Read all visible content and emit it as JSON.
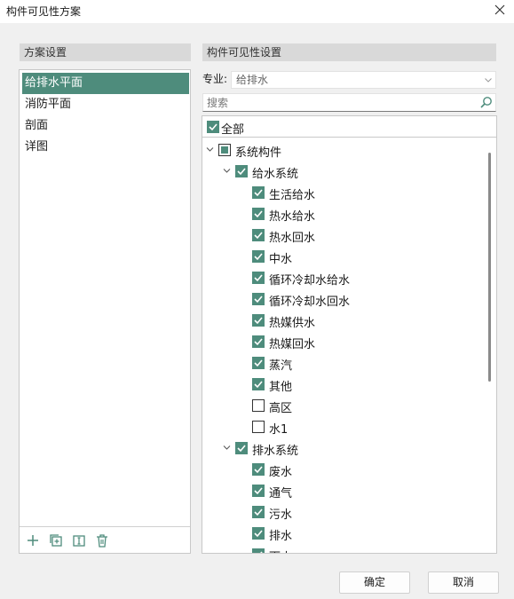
{
  "window": {
    "title": "构件可见性方案"
  },
  "left": {
    "header": "方案设置",
    "items": [
      {
        "label": "给排水平面",
        "selected": true
      },
      {
        "label": "消防平面",
        "selected": false
      },
      {
        "label": "剖面",
        "selected": false
      },
      {
        "label": "详图",
        "selected": false
      }
    ],
    "toolbar": [
      "add-icon",
      "copy-icon",
      "rename-icon",
      "delete-icon"
    ]
  },
  "right": {
    "header": "构件可见性设置",
    "major_label": "专业:",
    "major_value": "给排水",
    "search_placeholder": "搜索",
    "all_label": "全部",
    "tree": [
      {
        "label": "系统构件",
        "state": "partial",
        "level": 0,
        "expanded": true
      },
      {
        "label": "给水系统",
        "state": "checked",
        "level": 1,
        "expanded": true
      },
      {
        "label": "生活给水",
        "state": "checked",
        "level": 2
      },
      {
        "label": "热水给水",
        "state": "checked",
        "level": 2
      },
      {
        "label": "热水回水",
        "state": "checked",
        "level": 2
      },
      {
        "label": "中水",
        "state": "checked",
        "level": 2
      },
      {
        "label": "循环冷却水给水",
        "state": "checked",
        "level": 2
      },
      {
        "label": "循环冷却水回水",
        "state": "checked",
        "level": 2
      },
      {
        "label": "热媒供水",
        "state": "checked",
        "level": 2
      },
      {
        "label": "热媒回水",
        "state": "checked",
        "level": 2
      },
      {
        "label": "蒸汽",
        "state": "checked",
        "level": 2
      },
      {
        "label": "其他",
        "state": "checked",
        "level": 2
      },
      {
        "label": "高区",
        "state": "unchecked",
        "level": 2
      },
      {
        "label": "水1",
        "state": "unchecked",
        "level": 2
      },
      {
        "label": "排水系统",
        "state": "checked",
        "level": 1,
        "expanded": true
      },
      {
        "label": "废水",
        "state": "checked",
        "level": 2
      },
      {
        "label": "通气",
        "state": "checked",
        "level": 2
      },
      {
        "label": "污水",
        "state": "checked",
        "level": 2
      },
      {
        "label": "排水",
        "state": "checked",
        "level": 2
      },
      {
        "label": "雨水",
        "state": "checked",
        "level": 2
      }
    ]
  },
  "buttons": {
    "ok": "确定",
    "cancel": "取消"
  },
  "colors": {
    "accent": "#4e8c7c"
  }
}
